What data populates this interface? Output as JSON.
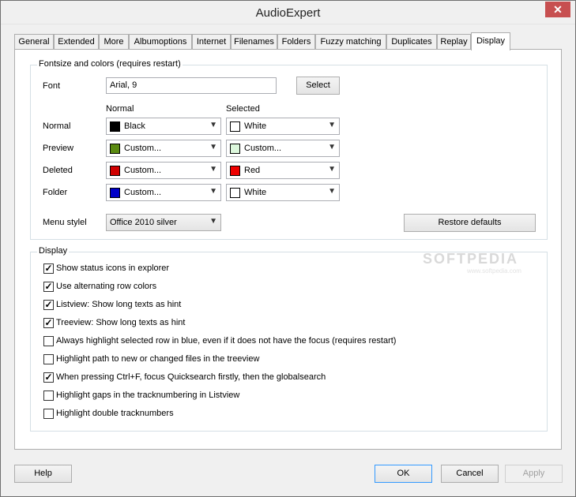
{
  "window": {
    "title": "AudioExpert",
    "close_glyph": "✕"
  },
  "tabs": [
    {
      "label": "General"
    },
    {
      "label": "Extended"
    },
    {
      "label": "More"
    },
    {
      "label": "Albumoptions"
    },
    {
      "label": "Internet"
    },
    {
      "label": "Filenames"
    },
    {
      "label": "Folders"
    },
    {
      "label": "Fuzzy matching"
    },
    {
      "label": "Duplicates"
    },
    {
      "label": "Replay"
    },
    {
      "label": "Display"
    }
  ],
  "active_tab": "Display",
  "fonts_group": {
    "legend": "Fontsize and colors (requires restart)",
    "font_label": "Font",
    "font_value": "Arial, 9",
    "select_button": "Select",
    "col_normal": "Normal",
    "col_selected": "Selected",
    "rows": [
      {
        "label": "Normal",
        "normal": {
          "text": "Black",
          "color": "#000000"
        },
        "selected": {
          "text": "White",
          "color": "#ffffff"
        }
      },
      {
        "label": "Preview",
        "normal": {
          "text": "Custom...",
          "color": "#5a8a10"
        },
        "selected": {
          "text": "Custom...",
          "color": "#dcf7dc"
        }
      },
      {
        "label": "Deleted",
        "normal": {
          "text": "Custom...",
          "color": "#d00000"
        },
        "selected": {
          "text": "Red",
          "color": "#ee0000"
        }
      },
      {
        "label": "Folder",
        "normal": {
          "text": "Custom...",
          "color": "#0000c8"
        },
        "selected": {
          "text": "White",
          "color": "#ffffff"
        }
      }
    ],
    "menu_style_label": "Menu stylel",
    "menu_style_value": "Office 2010 silver",
    "restore_button": "Restore defaults"
  },
  "display_group": {
    "legend": "Display",
    "options": [
      {
        "label": "Show status icons in explorer",
        "checked": true
      },
      {
        "label": "Use alternating row colors",
        "checked": true
      },
      {
        "label": "Listview: Show long texts as hint",
        "checked": true
      },
      {
        "label": "Treeview: Show long texts as hint",
        "checked": true
      },
      {
        "label": "Always highlight selected row in blue, even if it does not have the focus (requires restart)",
        "checked": false
      },
      {
        "label": "Highlight path to new or changed files in the treeview",
        "checked": false
      },
      {
        "label": "When pressing Ctrl+F, focus Quicksearch firstly, then the globalsearch",
        "checked": true
      },
      {
        "label": "Highlight gaps in the tracknumbering in Listview",
        "checked": false
      },
      {
        "label": "Highlight double tracknumbers",
        "checked": false
      }
    ]
  },
  "watermark": {
    "text": "SOFTPEDIA",
    "sub": "www.softpedia.com"
  },
  "footer": {
    "help": "Help",
    "ok": "OK",
    "cancel": "Cancel",
    "apply": "Apply"
  }
}
